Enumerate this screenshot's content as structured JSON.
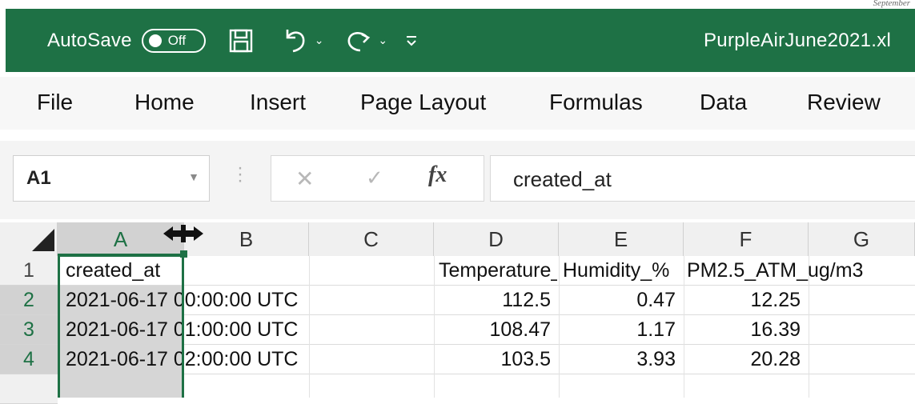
{
  "corner_note": "September",
  "titlebar": {
    "autosave_label": "AutoSave",
    "toggle_state": "Off",
    "filename": "PurpleAirJune2021.xl",
    "icons": [
      "save-icon",
      "undo-icon",
      "redo-icon",
      "customize-qat-icon"
    ],
    "color": "#1e7145"
  },
  "ribbon": {
    "tabs": [
      "File",
      "Home",
      "Insert",
      "Page Layout",
      "Formulas",
      "Data",
      "Review"
    ]
  },
  "formula_bar": {
    "name_box": "A1",
    "fx_label": "fx",
    "formula": "created_at"
  },
  "grid": {
    "columns": [
      "A",
      "B",
      "C",
      "D",
      "E",
      "F",
      "G"
    ],
    "selected_column": "A",
    "rows": [
      "1",
      "2",
      "3",
      "4"
    ],
    "selected_rows": [
      "2",
      "3",
      "4"
    ],
    "cells": {
      "r1": {
        "a": "created_at",
        "d": "Temperature_F",
        "e": "Humidity_%",
        "f": "PM2.5_ATM_ug/m3"
      },
      "r2": {
        "a": "2021-06-17 00:00:00 UTC",
        "d": "112.5",
        "e": "0.47",
        "f": "12.25"
      },
      "r3": {
        "a": "2021-06-17 01:00:00 UTC",
        "d": "108.47",
        "e": "1.17",
        "f": "16.39"
      },
      "r4": {
        "a": "2021-06-17 02:00:00 UTC",
        "d": "103.5",
        "e": "3.93",
        "f": "20.28"
      }
    }
  }
}
